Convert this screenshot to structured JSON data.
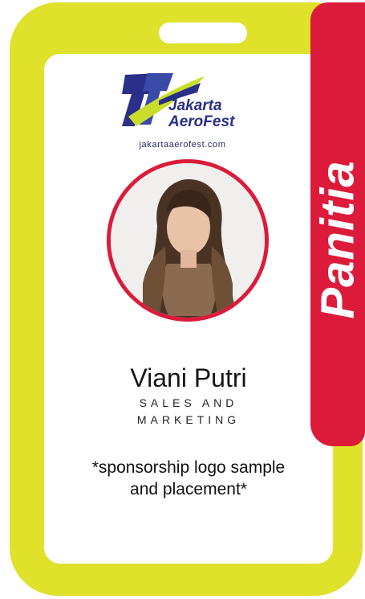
{
  "colors": {
    "lanyard_frame": "#dfe12b",
    "accent_red": "#dc1b3a",
    "logo_navy": "#2a2f87"
  },
  "logo": {
    "line1": "Jakarta",
    "line2": "AeroFest",
    "website": "jakartaaerofest.com"
  },
  "role_tab": {
    "label": "Panitia"
  },
  "person": {
    "name": "Viani Putri",
    "title_line1": "SALES AND",
    "title_line2": "MARKETING"
  },
  "sponsor_note": {
    "line1": "*sponsorship logo sample",
    "line2": "and placement*"
  }
}
